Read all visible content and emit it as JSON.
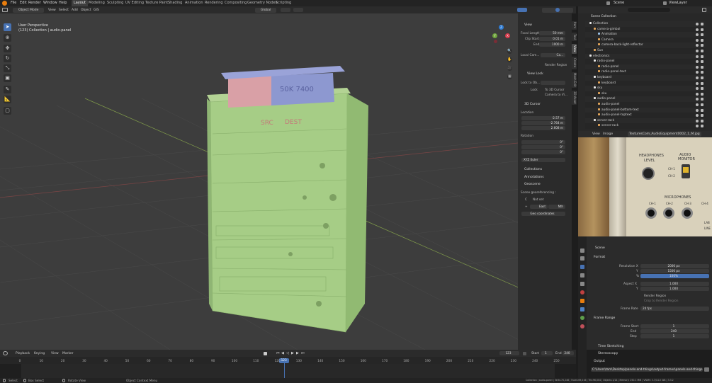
{
  "menu": [
    "File",
    "Edit",
    "Render",
    "Window",
    "Help"
  ],
  "workspaces": [
    "Layout",
    "Modeling",
    "Sculpting",
    "UV Editing",
    "Texture Paint",
    "Shading",
    "Animation",
    "Rendering",
    "Compositing",
    "Geometry Nodes",
    "Scripting"
  ],
  "active_workspace": "Layout",
  "scene_name": "Scene",
  "view_layer": "ViewLayer",
  "viewport": {
    "mode": "Object Mode",
    "header_menus": [
      "View",
      "Select",
      "Add",
      "Object",
      "GIS"
    ],
    "orientation": "Global",
    "perspective_label": "User Perspective",
    "collection_label": "(123) Collection | audio-panel",
    "options_label": "Options",
    "model_labels": {
      "src": "SRC",
      "dest": "DEST",
      "radio": "50K 7400"
    },
    "gizmo_axes": {
      "x": "X",
      "y": "Y",
      "z": "Z"
    }
  },
  "n_panel": {
    "tabs": [
      "Item",
      "Tool",
      "View",
      "Create",
      "Mesh Edit",
      "3D Asset"
    ],
    "view_header": "View",
    "focal_length_label": "Focal Length",
    "focal_length": "50 mm",
    "clip_start_label": "Clip Start",
    "clip_start": "0.01 m",
    "clip_end_label": "End",
    "clip_end": "1000 m",
    "local_camera_label": "Local Cam...",
    "local_camera_value": "Ca...",
    "render_region": "Render Region",
    "view_lock": "View Lock",
    "lock_to_obj": "Lock to Ob...",
    "lock_label": "Lock",
    "to_3d_cursor": "To 3D Cursor",
    "camera_to_view": "Camera to Vi...",
    "cursor_header": "3D Cursor",
    "location_label": "Location",
    "loc": [
      [
        "X",
        "-2.57 m"
      ],
      [
        "Y",
        "-2.764 m"
      ],
      [
        "Z",
        "2.608 m"
      ]
    ],
    "rotation_label": "Rotation",
    "rot": [
      [
        "X",
        "0°"
      ],
      [
        "Y",
        "0°"
      ],
      [
        "Z",
        "0°"
      ]
    ],
    "rotation_mode": "XYZ Euler",
    "collections": "Collections",
    "annotations": "Annotations",
    "geoscene": "Geoscene",
    "georef_label": "Scene georeferencing :",
    "crs_label": "C",
    "crs_value": "Not set",
    "origin_label": "+",
    "origin_east": "East",
    "origin_north": "Nth",
    "geo_button": "Geo coordinates"
  },
  "outliner": {
    "root": "Scene Collection",
    "rows": [
      {
        "text": "Collection",
        "indent": 1,
        "color": "#e6e6e6"
      },
      {
        "text": "camera-gimbal",
        "indent": 2,
        "color": "#e6a85c"
      },
      {
        "text": "Animation",
        "indent": 3,
        "color": "#9bc1e8"
      },
      {
        "text": "Camera",
        "indent": 3,
        "color": "#e6a85c"
      },
      {
        "text": "camera-back-light-reflector",
        "indent": 3,
        "color": "#e6a85c"
      },
      {
        "text": "Sun",
        "indent": 2,
        "color": "#e6a85c"
      },
      {
        "text": "electronics",
        "indent": 1,
        "color": "#e6e6e6"
      },
      {
        "text": "radio-panel",
        "indent": 2,
        "color": "#e6e6e6"
      },
      {
        "text": "radio-panel",
        "indent": 3,
        "color": "#e6a85c"
      },
      {
        "text": "radio-panel-text",
        "indent": 3,
        "color": "#e6a85c"
      },
      {
        "text": "keyboard",
        "indent": 2,
        "color": "#e6e6e6"
      },
      {
        "text": "keyboard",
        "indent": 3,
        "color": "#e6a85c"
      },
      {
        "text": "sku",
        "indent": 2,
        "color": "#e6e6e6"
      },
      {
        "text": "sku",
        "indent": 3,
        "color": "#e6a85c"
      },
      {
        "text": "audio-panel",
        "indent": 2,
        "color": "#e6e6e6"
      },
      {
        "text": "audio-panel",
        "indent": 3,
        "color": "#e6a85c"
      },
      {
        "text": "audio-panel-bottom-text",
        "indent": 3,
        "color": "#e6a85c"
      },
      {
        "text": "audio-panel-toptext",
        "indent": 3,
        "color": "#e6a85c"
      },
      {
        "text": "server-rack",
        "indent": 2,
        "color": "#e6e6e6"
      },
      {
        "text": "server-rack",
        "indent": 3,
        "color": "#e6a85c"
      }
    ]
  },
  "image_editor": {
    "menus": [
      "View",
      "Image"
    ],
    "image_name": "TexturesCom_AudioEquipment0002_1_M.jpg",
    "labels": {
      "headphones": "HEADPHONES",
      "level": "LEVEL",
      "audio": "AUDIO",
      "monitor": "MONITOR",
      "microphones": "MICROPHONES",
      "ch1": "CH-1",
      "ch2": "CH-2",
      "ch3": "CH-3",
      "ch4": "CH-4",
      "lab": "LAB",
      "line": "LINE"
    }
  },
  "properties": {
    "context": "Scene",
    "format_header": "Format",
    "resolution_x_label": "Resolution X",
    "resolution_x": "2000 px",
    "resolution_y_label": "Y",
    "resolution_y": "1500 px",
    "percent_label": "%",
    "percent": "100%",
    "aspect_x_label": "Aspect X",
    "aspect_x": "1.000",
    "aspect_y_label": "Y",
    "aspect_y": "1.000",
    "render_region": "Render Region",
    "crop": "Crop to Render Region",
    "frame_rate_label": "Frame Rate",
    "frame_rate": "24 fps",
    "frame_range_header": "Frame Range",
    "frame_start_label": "Frame Start",
    "frame_start": "1",
    "end_label": "End",
    "end": "240",
    "step_label": "Step",
    "step": "1",
    "time_stretching": "Time Stretching",
    "stereoscopy": "Stereoscopy",
    "output_header": "Output",
    "output_path": "C:\\Users\\tam\\Desktop\\panels-and-things\\output-frames\\panels-and-things-v1\\"
  },
  "timeline": {
    "menus": [
      "Playback",
      "Keying",
      "View",
      "Marker"
    ],
    "current_frame": "123",
    "start_label": "Start",
    "start": "1",
    "end_label": "End",
    "end": "240",
    "ticks": [
      "0",
      "10",
      "20",
      "30",
      "40",
      "50",
      "60",
      "70",
      "80",
      "90",
      "100",
      "110",
      "120",
      "130",
      "140",
      "150",
      "160",
      "170",
      "180",
      "190",
      "200",
      "210",
      "220",
      "230",
      "240",
      "250"
    ],
    "playhead": "123"
  },
  "status_bar": {
    "select": "Select",
    "box_select": "Box Select",
    "rotate_view": "Rotate View",
    "context_menu": "Object Context Menu",
    "stats": "Collection | audio-panel | Verts:70,246 | Faces:69,016 | Tris:96,004 | Objects:1/14 | Memory: 250.1 MiB | VRAM: 3.7/14.0 GiB | 3.3.2"
  },
  "colors": {
    "accent": "#4772b3",
    "model_green": "#9fc97e",
    "model_blue": "#8896cf",
    "model_red": "#d99aa1",
    "bg_viewport": "#3d3d3d"
  }
}
